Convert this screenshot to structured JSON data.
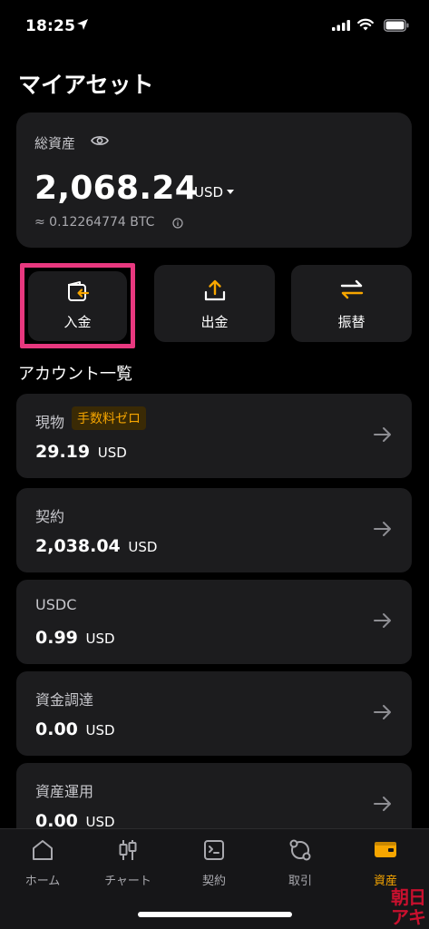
{
  "status_bar": {
    "time": "18:25"
  },
  "page": {
    "title": "マイアセット"
  },
  "total_assets": {
    "label": "総資産",
    "value": "2,068.24",
    "currency": "USD",
    "btc_value": "≈ 0.12264774 BTC"
  },
  "actions": {
    "deposit": "入金",
    "withdraw": "出金",
    "transfer": "振替"
  },
  "accounts_section": {
    "title": "アカウント一覧"
  },
  "accounts": [
    {
      "name": "現物",
      "badge": "手数料ゼロ",
      "value": "29.19",
      "unit": "USD"
    },
    {
      "name": "契約",
      "value": "2,038.04",
      "unit": "USD"
    },
    {
      "name": "USDC",
      "value": "0.99",
      "unit": "USD"
    },
    {
      "name": "資金調達",
      "value": "0.00",
      "unit": "USD"
    },
    {
      "name": "資産運用",
      "value": "0.00",
      "unit": "USD"
    }
  ],
  "tabs": [
    {
      "label": "ホーム",
      "icon": "home-icon"
    },
    {
      "label": "チャート",
      "icon": "candlestick-icon"
    },
    {
      "label": "契約",
      "icon": "terminal-icon"
    },
    {
      "label": "取引",
      "icon": "trade-icon"
    },
    {
      "label": "資産",
      "icon": "wallet-icon",
      "active": true
    }
  ],
  "watermark": {
    "line1": "朝日",
    "line2": "アキ"
  },
  "colors": {
    "accent": "#f7a600",
    "highlight": "#e8387f",
    "card": "#1c1c1e",
    "background": "#000000"
  }
}
